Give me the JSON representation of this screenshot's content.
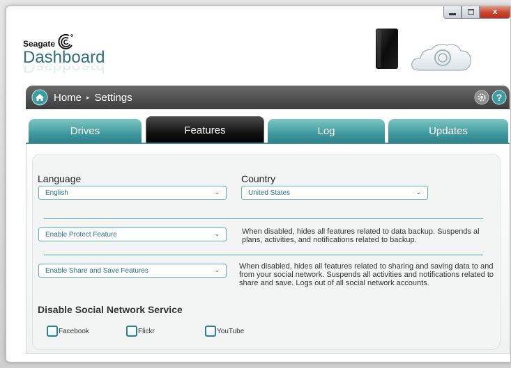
{
  "window": {
    "controls": {
      "minimize": "minimize",
      "maximize": "maximize",
      "close": "x"
    }
  },
  "brand": {
    "company": "Seagate",
    "product": "Dashboard"
  },
  "breadcrumb": {
    "home": "Home",
    "separator": "▸",
    "current": "Settings"
  },
  "tabs": [
    {
      "label": "Drives",
      "active": false
    },
    {
      "label": "Features",
      "active": true
    },
    {
      "label": "Log",
      "active": false
    },
    {
      "label": "Updates",
      "active": false
    }
  ],
  "settings": {
    "language": {
      "label": "Language",
      "value": "English"
    },
    "country": {
      "label": "Country",
      "value": "United States"
    },
    "protect": {
      "value": "Enable Protect Feature",
      "description": "When disabled, hides all features related to data backup. Suspends al plans, activities, and notifications related to backup."
    },
    "share": {
      "value": "Enable Share and Save Features",
      "description": "When disabled, hides all features related to sharing and saving data to and from your social network. Suspends all activities and notifications related to share and save. Logs out of all social network accounts."
    },
    "social": {
      "title": "Disable Social Network Service",
      "options": [
        {
          "label": "Facebook",
          "checked": false
        },
        {
          "label": "Flickr",
          "checked": false
        },
        {
          "label": "YouTube",
          "checked": false
        }
      ]
    }
  },
  "colors": {
    "teal_accent": "#3f9aa0",
    "brand_text": "#2f6e7c",
    "nav_dark": "#3c3c3c",
    "close_red": "#c8452f"
  },
  "icons": [
    "home-icon",
    "gear-icon",
    "help-icon",
    "chevron-down-icon",
    "seagate-logo-icon",
    "drive-icon",
    "cloud-icon"
  ]
}
